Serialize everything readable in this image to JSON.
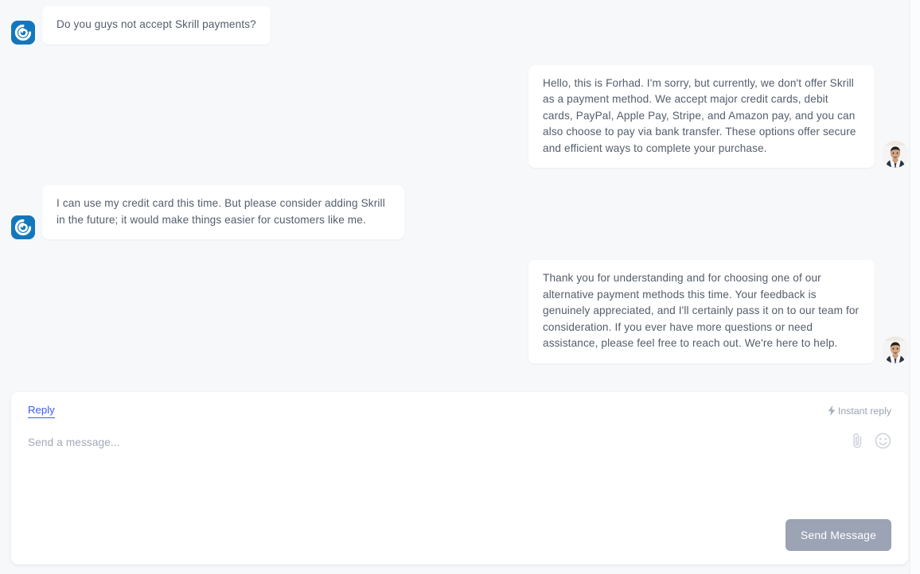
{
  "theme": {
    "page_bg": "#f7f8fa",
    "bubble_bg": "#ffffff",
    "text": "#545d6c",
    "accent_link": "#3d5afe",
    "customer_avatar_bg": "#1377bd",
    "send_button_bg": "#9ba3b4",
    "muted_text": "#9aa2b4"
  },
  "conversation": {
    "messages": [
      {
        "id": "m1",
        "direction": "inbound",
        "sender": "customer",
        "avatar": "customer-logo-avatar",
        "text": "Do you guys not accept Skrill payments?"
      },
      {
        "id": "m2",
        "direction": "outbound",
        "sender": "agent",
        "avatar": "agent-photo-avatar",
        "text": "Hello, this is Forhad. I'm sorry, but currently, we don't offer Skrill as a payment method. We accept major credit cards, debit cards, PayPal, Apple Pay, Stripe, and Amazon pay, and you can also choose to pay via bank transfer. These options offer secure and efficient ways to complete your purchase."
      },
      {
        "id": "m3",
        "direction": "inbound",
        "sender": "customer",
        "avatar": "customer-logo-avatar",
        "text": "I can use my credit card this time. But please consider adding Skrill in the future; it would make things easier for customers like me."
      },
      {
        "id": "m4",
        "direction": "outbound",
        "sender": "agent",
        "avatar": "agent-photo-avatar",
        "text": "Thank you for understanding and for choosing one of our alternative payment methods this time. Your feedback is genuinely appreciated, and I'll certainly pass it on to our team for consideration. If you ever have more questions or need assistance, please feel free to reach out. We're here to help."
      }
    ]
  },
  "composer": {
    "tabs": [
      {
        "id": "reply",
        "label": "Reply",
        "active": true
      }
    ],
    "instant_reply": {
      "label": "Instant reply",
      "icon": "lightning-bolt-icon"
    },
    "message_input": {
      "value": "",
      "placeholder": "Send a message..."
    },
    "tools": [
      {
        "id": "attach",
        "icon": "paperclip-icon",
        "label": "Attach file"
      },
      {
        "id": "emoji",
        "icon": "smiley-face-icon",
        "label": "Insert emoji"
      }
    ],
    "send_button": {
      "label": "Send Message"
    }
  }
}
